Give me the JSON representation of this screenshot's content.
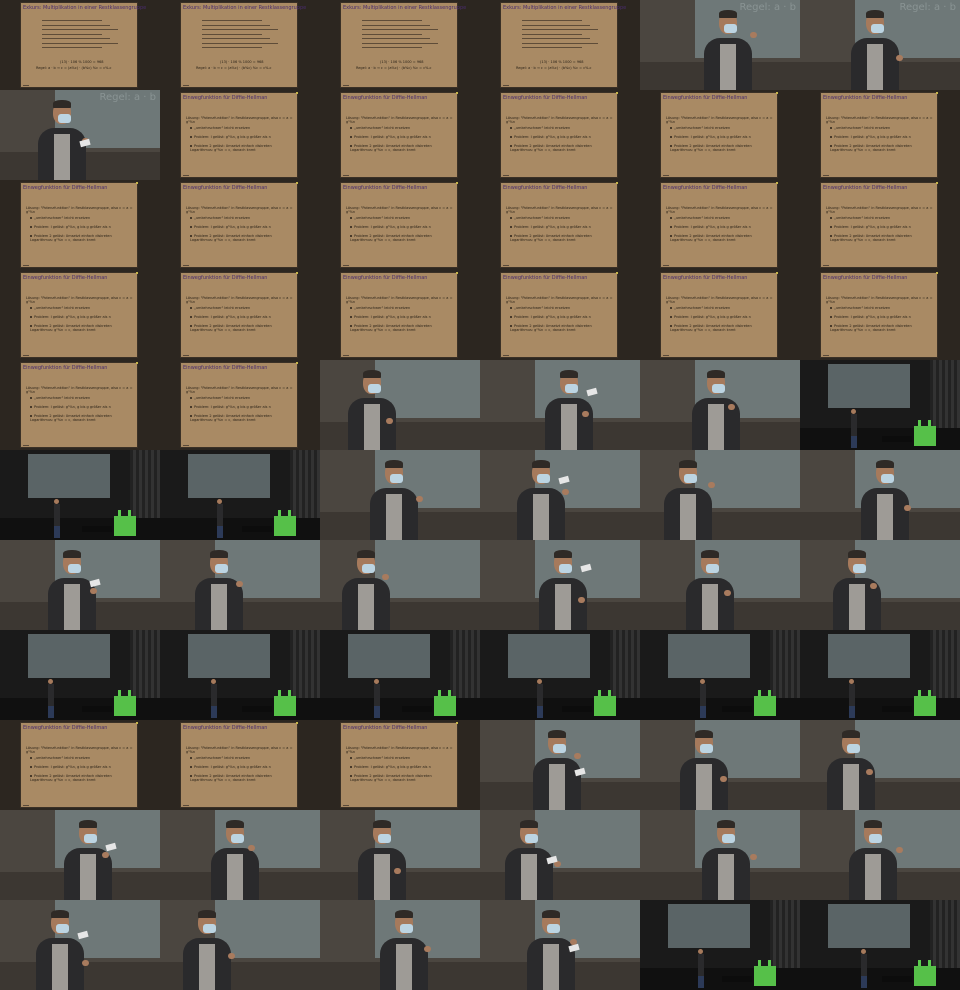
{
  "slide_texts": {
    "exkurs_title": "Exkurs: Multiplikation in einer Restklassengruppe",
    "exkurs_result": "(13) · 106 % 1000 = 968",
    "exkurs_rule": "Regel: a · b ⇒ c = (a%c) · (b%c) %c = c%.c",
    "dh_title": "Einwegfunktion für Diffie-Hellman",
    "dh_intro": "Lösung: \"Potenzfunktion\" in Restklassengruppe, also c = a = gᵃ%n",
    "dh_b1": "„umkehrschwer\" leicht ersetzen",
    "dh_b2": "Problem: I gelöst: gᵃ%n, g bis g größer als n",
    "dh_b3": "Problem 2 gelöst: Umsetzt einfach diskreten Logarithmus: gᵃ%n = c, danach knmt",
    "speaker_screen_label": "Regel: a · b"
  },
  "thumbnails": [
    "exkurs",
    "exkurs",
    "exkurs",
    "exkurs",
    "speaker",
    "speaker",
    "speaker",
    "dh",
    "dh",
    "dh",
    "dh",
    "dh",
    "dh",
    "dh",
    "dh",
    "dh",
    "dh",
    "dh",
    "dh",
    "dh",
    "dh",
    "dh",
    "dh",
    "dh",
    "dh",
    "dh",
    "speaker",
    "speaker",
    "speaker",
    "stage",
    "stage",
    "stage",
    "speaker",
    "speaker",
    "speaker",
    "speaker",
    "speaker",
    "speaker",
    "speaker",
    "speaker",
    "speaker",
    "speaker",
    "stage",
    "stage",
    "stage",
    "stage",
    "stage",
    "stage",
    "dh",
    "dh",
    "dh",
    "speaker",
    "speaker",
    "speaker",
    "speaker",
    "speaker",
    "speaker",
    "speaker",
    "speaker",
    "speaker",
    "speaker",
    "speaker",
    "speaker",
    "speaker",
    "stage",
    "stage"
  ]
}
